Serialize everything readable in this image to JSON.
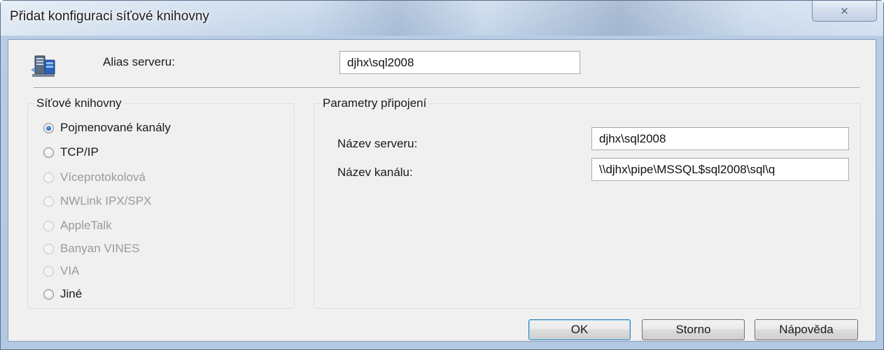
{
  "window": {
    "title": "Přidat konfiguraci síťové knihovny",
    "close_glyph": "✕"
  },
  "alias": {
    "icon": "server-network-icon",
    "label": "Alias serveru:",
    "value": "djhx\\sql2008"
  },
  "libraries": {
    "title": "Síťové knihovny",
    "options": [
      {
        "label": "Pojmenované kanály",
        "checked": true,
        "enabled": true
      },
      {
        "label": "TCP/IP",
        "checked": false,
        "enabled": true
      },
      {
        "label": "Víceprotokolová",
        "checked": false,
        "enabled": false
      },
      {
        "label": "NWLink IPX/SPX",
        "checked": false,
        "enabled": false
      },
      {
        "label": "AppleTalk",
        "checked": false,
        "enabled": false
      },
      {
        "label": "Banyan VINES",
        "checked": false,
        "enabled": false
      },
      {
        "label": "VIA",
        "checked": false,
        "enabled": false
      },
      {
        "label": "Jiné",
        "checked": false,
        "enabled": true
      }
    ]
  },
  "params": {
    "title": "Parametry připojení",
    "server_name_label": "Název serveru:",
    "server_name_value": "djhx\\sql2008",
    "pipe_name_label": "Název kanálu:",
    "pipe_name_value": "\\\\djhx\\pipe\\MSSQL$sql2008\\sql\\q"
  },
  "buttons": {
    "ok": "OK",
    "cancel": "Storno",
    "help": "Nápověda"
  },
  "colors": {
    "titlebar": "#b6cbe4",
    "client_bg": "#f0f0f0",
    "radio_checked": "#2a6fc4"
  }
}
